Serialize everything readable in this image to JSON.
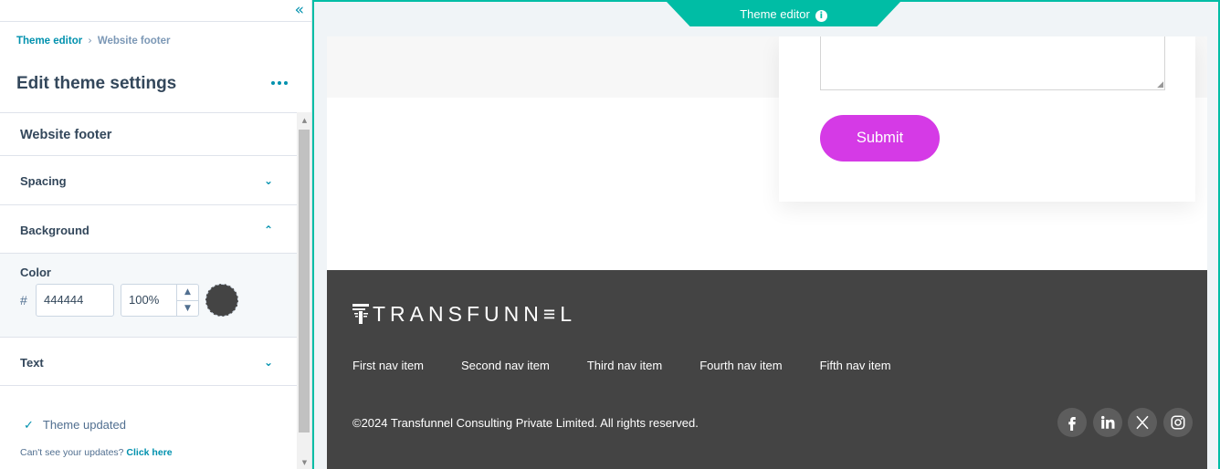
{
  "panel": {
    "breadcrumb": {
      "link": "Theme editor",
      "current": "Website footer"
    },
    "title": "Edit theme settings",
    "sections": {
      "footer": "Website footer",
      "spacing": "Spacing",
      "background": "Background",
      "text": "Text"
    },
    "color": {
      "label": "Color",
      "hash": "#",
      "hex": "444444",
      "opacity": "100%",
      "swatch_color": "#444444"
    },
    "status": "Theme updated",
    "hint": {
      "text": "Can't see your updates?",
      "link": "Click here"
    }
  },
  "preview": {
    "tab": "Theme editor",
    "submit": "Submit",
    "logo": "TRANSFUNN≡L",
    "nav": [
      "First nav item",
      "Second nav item",
      "Third nav item",
      "Fourth nav item",
      "Fifth nav item"
    ],
    "copyright": "©2024 Transfunnel Consulting Private Limited. All rights reserved.",
    "socials": [
      "facebook-icon",
      "linkedin-icon",
      "x-icon",
      "instagram-icon"
    ],
    "colors": {
      "accent": "#00bda5",
      "link": "#0091ae",
      "submit": "#d53ae6",
      "footer_bg": "#444444"
    }
  }
}
